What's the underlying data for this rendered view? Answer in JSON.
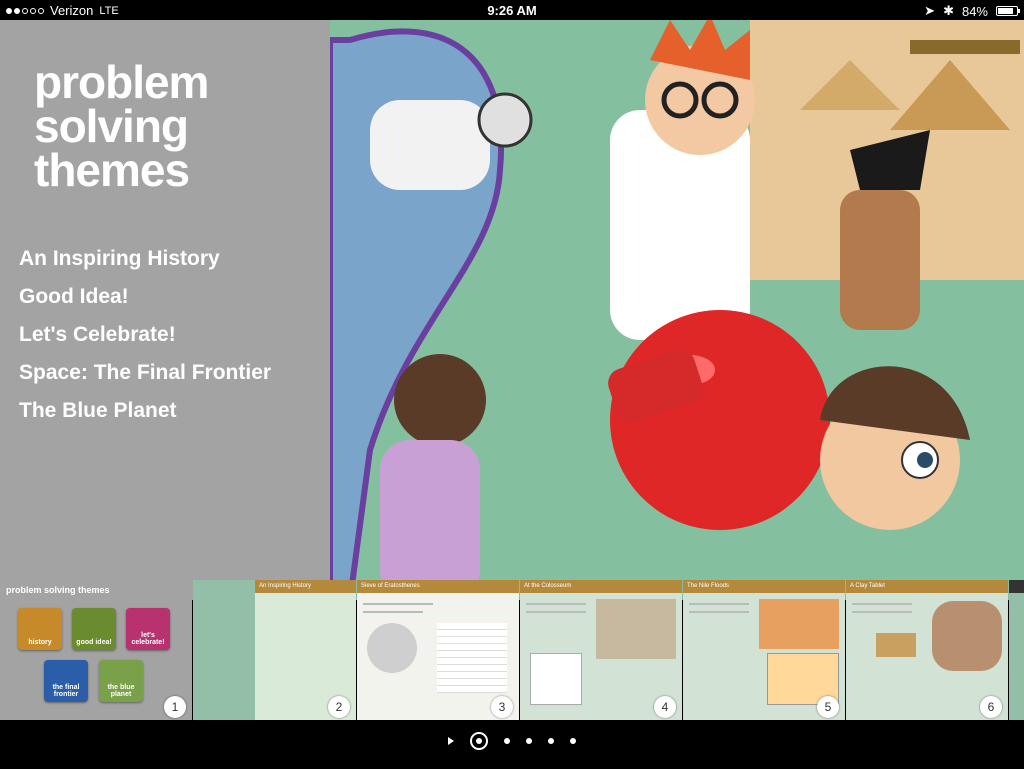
{
  "status": {
    "carrier": "Verizon",
    "network": "LTE",
    "time": "9:26 AM",
    "battery_percent": "84%",
    "battery_level": 0.84
  },
  "hero": {
    "title_lines": [
      "problem",
      "solving",
      "themes"
    ],
    "menu": [
      "An Inspiring History",
      "Good Idea!",
      "Let's Celebrate!",
      "Space: The Final Frontier",
      "The Blue Planet"
    ]
  },
  "strip": {
    "mini_title": "problem solving themes",
    "thumbs": [
      {
        "label": "history",
        "color": "#c78a2a"
      },
      {
        "label": "good idea!",
        "color": "#6b8b2f"
      },
      {
        "label": "let's celebrate!",
        "color": "#b8326f"
      },
      {
        "label": "the final frontier",
        "color": "#2a5ea8"
      },
      {
        "label": "the blue planet",
        "color": "#7aa04a"
      }
    ],
    "pages": [
      {
        "num": "1"
      },
      {
        "num": "2",
        "head": "An Inspiring History"
      },
      {
        "num": "3",
        "head": "Sieve of Eratosthenes"
      },
      {
        "num": "4",
        "head": "At the Colosseum"
      },
      {
        "num": "5",
        "head": "The Nile Floods"
      },
      {
        "num": "6",
        "head": "A Clay Tablet"
      }
    ]
  },
  "pager": {
    "dots": 5,
    "active": 0
  }
}
